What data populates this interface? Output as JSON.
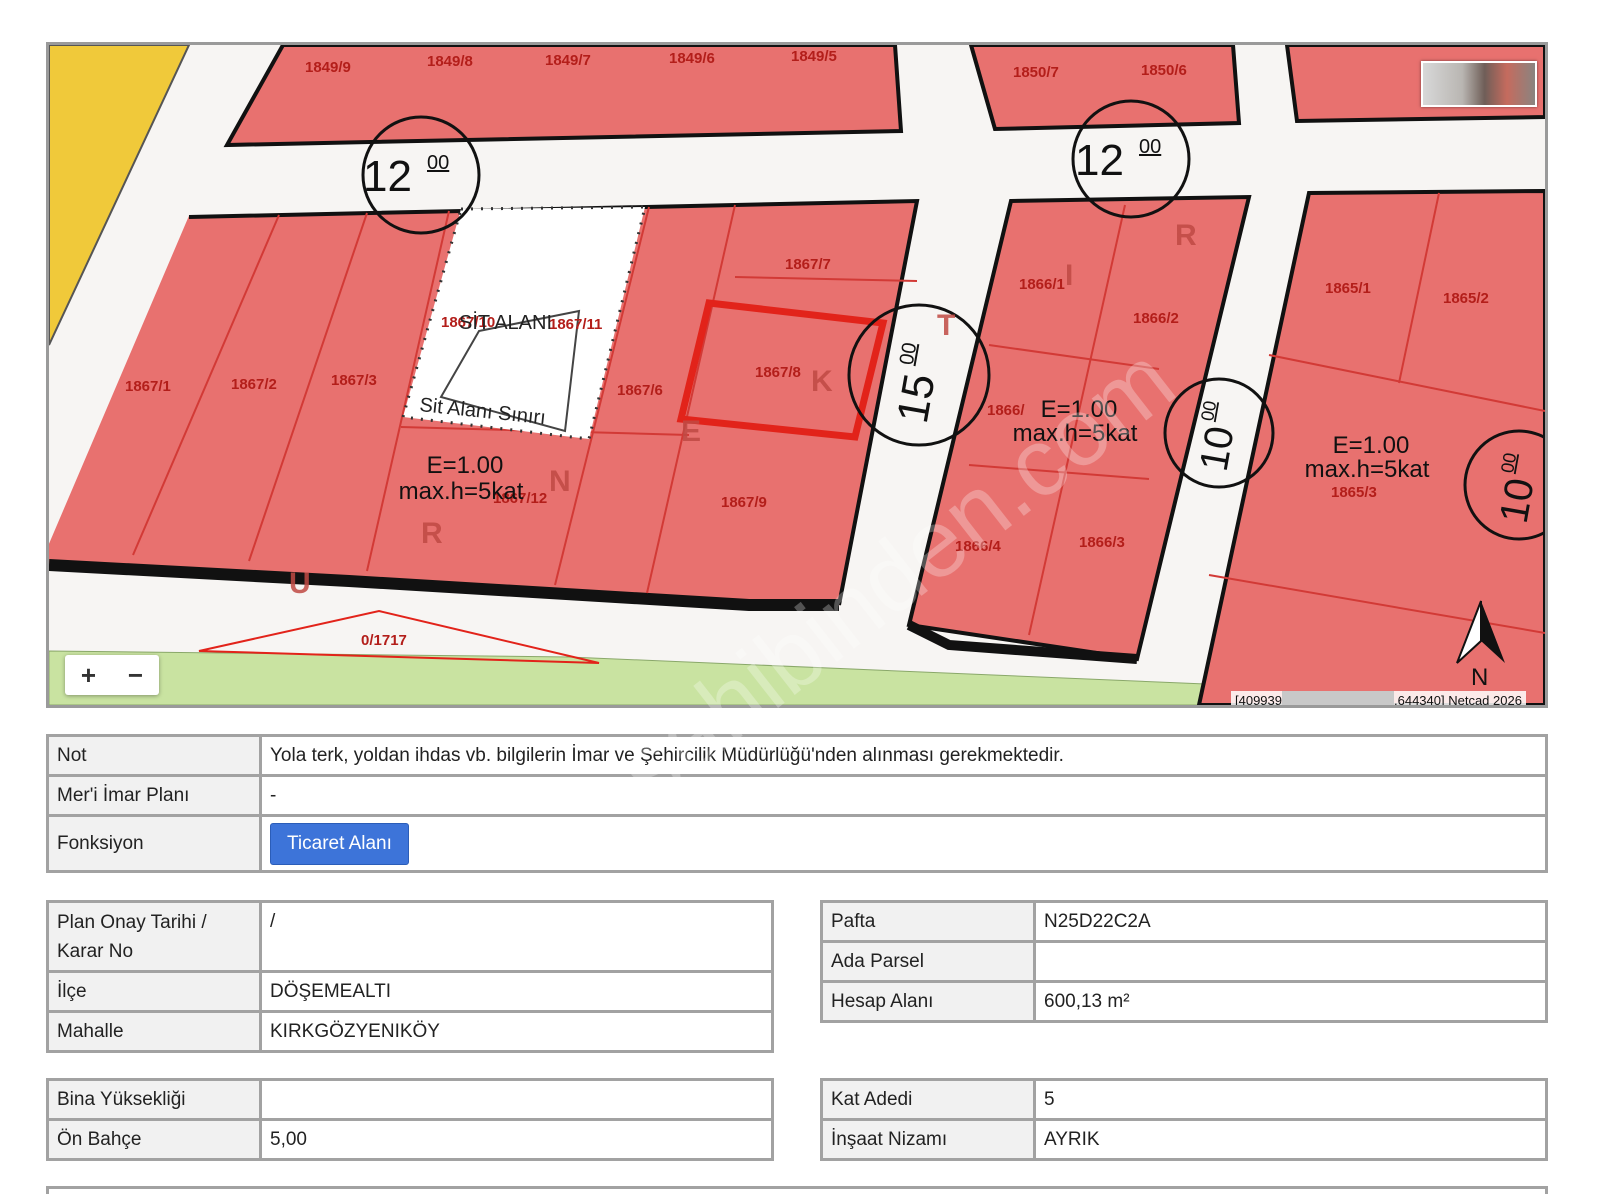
{
  "map": {
    "parcels": {
      "p1849_9": "1849/9",
      "p1849_8": "1849/8",
      "p1849_7": "1849/7",
      "p1849_6": "1849/6",
      "p1849_5": "1849/5",
      "p1850_7": "1850/7",
      "p1850_6": "1850/6",
      "p1867_1": "1867/1",
      "p1867_2": "1867/2",
      "p1867_3": "1867/3",
      "p1867_6": "1867/6",
      "p1867_7": "1867/7",
      "p1867_8": "1867/8",
      "p1867_9": "1867/9",
      "p1867_12": "1867/12",
      "p1867_10": "1867/10",
      "p1867_11": "1867/11",
      "p1866_1": "1866/1",
      "p1866_2": "1866/2",
      "p1866_3": "1866/3",
      "p1866_4": "1866/4",
      "p1866_5": "1866/",
      "p1865_1": "1865/1",
      "p1865_2": "1865/2",
      "p1865_3": "1865/3",
      "p0_1717": "0/1717"
    },
    "road_widths": {
      "w12_left": "12",
      "w12_left_sup": "00",
      "w12_right": "12",
      "w12_right_sup": "00",
      "w15": "15",
      "w15_sup": "00",
      "w10": "10",
      "w10_sup": "00",
      "w10_edge": "10",
      "w10_edge_sup": "00"
    },
    "sit_alani": "SİT ALANI",
    "sit_alani_siniri": "Sit Alanı Sınırı",
    "zoning_left": {
      "e": "E=1.00",
      "h": "max.h=5kat"
    },
    "zoning_mid": {
      "e": "E=1.00",
      "h": "max.h=5kat"
    },
    "zoning_right": {
      "e": "E=1.00",
      "h": "max.h=5kat"
    },
    "street_letters": [
      "U",
      "R",
      "N",
      "E",
      "K",
      "T",
      "I",
      "R"
    ],
    "north_label": "N",
    "zoom_in": "+",
    "zoom_out": "−",
    "attribution_left": "[409939",
    "attribution_right": ".644340] Netcad 2026",
    "watermark": "sahibinden.com",
    "colors": {
      "parcel": "#e8716f",
      "parcel_line": "#d23a36",
      "selected": "#e2231a",
      "green": "#c9e3a1",
      "yellow": "#f0c93a"
    }
  },
  "table_top": {
    "rows": [
      {
        "key": "Not",
        "value": "Yola terk, yoldan ihdas vb. bilgilerin İmar ve Şehircilik Müdürlüğü'nden alınması gerekmektedir."
      },
      {
        "key": "Mer'i İmar Planı",
        "value": "-"
      },
      {
        "key": "Fonksiyon",
        "button": "Ticaret Alanı"
      }
    ]
  },
  "table_left1": {
    "rows": [
      {
        "key": "Plan Onay Tarihi / Karar No",
        "value": "/"
      },
      {
        "key": "İlçe",
        "value": "DÖŞEMEALTI"
      },
      {
        "key": "Mahalle",
        "value": "KIRKGÖZYENIKÖY"
      }
    ]
  },
  "table_right1": {
    "rows": [
      {
        "key": "Pafta",
        "value": "N25D22C2A"
      },
      {
        "key": "Ada Parsel",
        "value": ""
      },
      {
        "key": "Hesap Alanı",
        "value": "600,13 m²"
      }
    ]
  },
  "table_left2": {
    "rows": [
      {
        "key": "Bina Yüksekliği",
        "value": ""
      },
      {
        "key": "Ön Bahçe",
        "value": "5,00"
      }
    ]
  },
  "table_right2": {
    "rows": [
      {
        "key": "Kat Adedi",
        "value": "5"
      },
      {
        "key": "İnşaat Nizamı",
        "value": "AYRIK"
      }
    ]
  }
}
